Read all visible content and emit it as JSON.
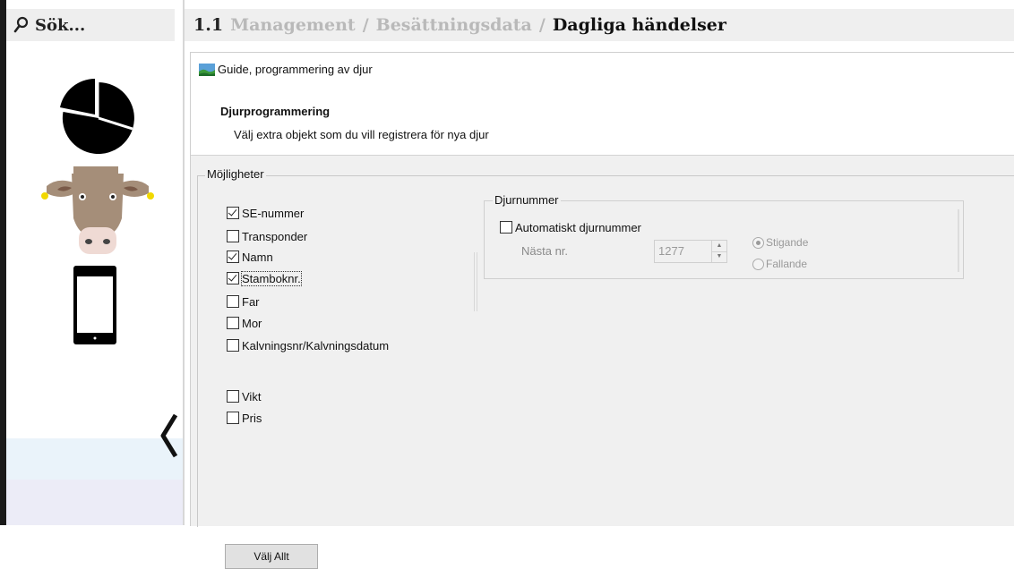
{
  "search": {
    "label": "Sök..."
  },
  "breadcrumb": {
    "number": "1.1",
    "items": [
      "Management",
      "Besättningsdata",
      "Dagliga händelser"
    ],
    "separator": "/"
  },
  "sidebar": {
    "icons": [
      "pie-chart-icon",
      "cow-icon",
      "mobile-phone-icon"
    ],
    "collapse_icon": "chevron-left-icon"
  },
  "wizard": {
    "title": "Guide, programmering av djur",
    "step_title": "Djurprogrammering",
    "step_subtitle": "Välj extra objekt som du vill registrera för nya djur"
  },
  "options": {
    "legend": "Möjligheter",
    "items": [
      {
        "label": "SE-nummer",
        "checked": true
      },
      {
        "label": "Transponder",
        "checked": false
      },
      {
        "label": "Namn",
        "checked": true
      },
      {
        "label": "Stamboknr.",
        "checked": true
      },
      {
        "label": "Far",
        "checked": false
      },
      {
        "label": "Mor",
        "checked": false
      },
      {
        "label": "Kalvningsnr/Kalvningsdatum",
        "checked": false
      },
      {
        "label": "Vikt",
        "checked": false
      },
      {
        "label": "Pris",
        "checked": false
      }
    ]
  },
  "djurnummer": {
    "legend": "Djurnummer",
    "auto_label": "Automatiskt djurnummer",
    "auto_checked": false,
    "next_label": "Nästa  nr.",
    "next_value": "1277",
    "order_options": [
      {
        "label": "Stigande",
        "selected": true
      },
      {
        "label": "Fallande",
        "selected": false
      }
    ]
  },
  "buttons": {
    "select_all": "Välj Allt"
  },
  "colors": {
    "breadcrumb_muted": "#b9b9b9",
    "content_bg": "#f0f0f0",
    "sidebar_band": "#eaf3fa"
  }
}
